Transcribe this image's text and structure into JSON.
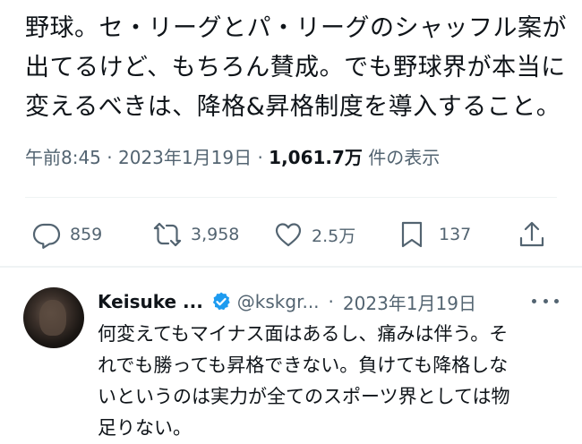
{
  "tweet": {
    "text_lines": [
      "野球。セ・リーグとパ・リーグのシャッフル案が",
      "出てるけど、もちろん賛成。でも野球界が本当に",
      "変えるべきは、降格&昇格制度を導入すること。"
    ],
    "time": "午前8:45",
    "separator": "·",
    "date": "2023年1月19日",
    "views_count": "1,061.7万",
    "views_label": "件の表示"
  },
  "actions": {
    "reply_count": "859",
    "retweet_count": "3,958",
    "like_count": "2.5万",
    "bookmark_count": "137",
    "icons": [
      "reply-icon",
      "retweet-icon",
      "like-icon",
      "bookmark-icon",
      "share-icon"
    ]
  },
  "reply": {
    "name": "Keisuke ...",
    "handle": "@kskgr...",
    "separator": "·",
    "date": "2023年1月19日",
    "text_lines": [
      "何変えてもマイナス面はあるし、痛みは伴う。そ",
      "れでも勝っても昇格できない。負けても降格しな",
      "いというのは実力が全てのスポーツ界としては物",
      "足りない。"
    ]
  },
  "colors": {
    "text_primary": "#0f1419",
    "text_secondary": "#536471",
    "divider": "#eff3f4",
    "verified_badge": "#1d9bf0"
  }
}
